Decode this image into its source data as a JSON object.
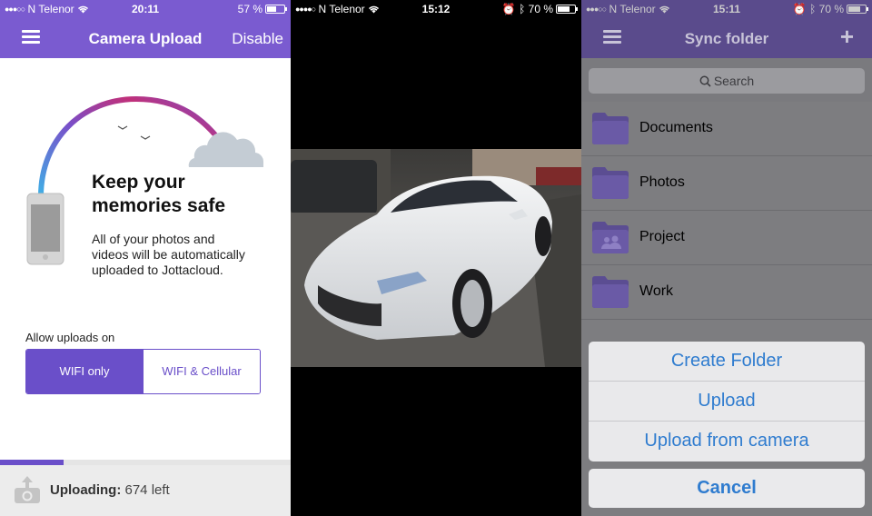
{
  "screen1": {
    "status": {
      "carrier": "N Telenor",
      "time": "20:11",
      "battery": "57 %",
      "battery_level": 0.57
    },
    "nav": {
      "title": "Camera Upload",
      "right": "Disable"
    },
    "heading_line1": "Keep your",
    "heading_line2": "memories safe",
    "desc_line1": "All of your photos and",
    "desc_line2": "videos will be automatically",
    "desc_line3": "uploaded to Jottacloud.",
    "allow_label": "Allow uploads on",
    "option_wifi": "WIFI only",
    "option_cellular": "WIFI & Cellular",
    "upload_label": "Uploading:",
    "upload_left": "674 left",
    "progress": 0.22
  },
  "screen2": {
    "status": {
      "carrier": "N Telenor",
      "time": "15:12",
      "battery": "70 %",
      "battery_level": 0.7
    }
  },
  "screen3": {
    "status": {
      "carrier": "N Telenor",
      "time": "15:11",
      "battery": "70 %",
      "battery_level": 0.7
    },
    "nav": {
      "title": "Sync folder",
      "right": "+"
    },
    "search_placeholder": "Search",
    "folders": [
      "Documents",
      "Photos",
      "Project",
      "Work"
    ],
    "actions": [
      "Create Folder",
      "Upload",
      "Upload from camera"
    ],
    "cancel": "Cancel"
  },
  "colors": {
    "brand": "#7a5bd0",
    "accent": "#6a4fc9",
    "link": "#2f7ccf"
  }
}
